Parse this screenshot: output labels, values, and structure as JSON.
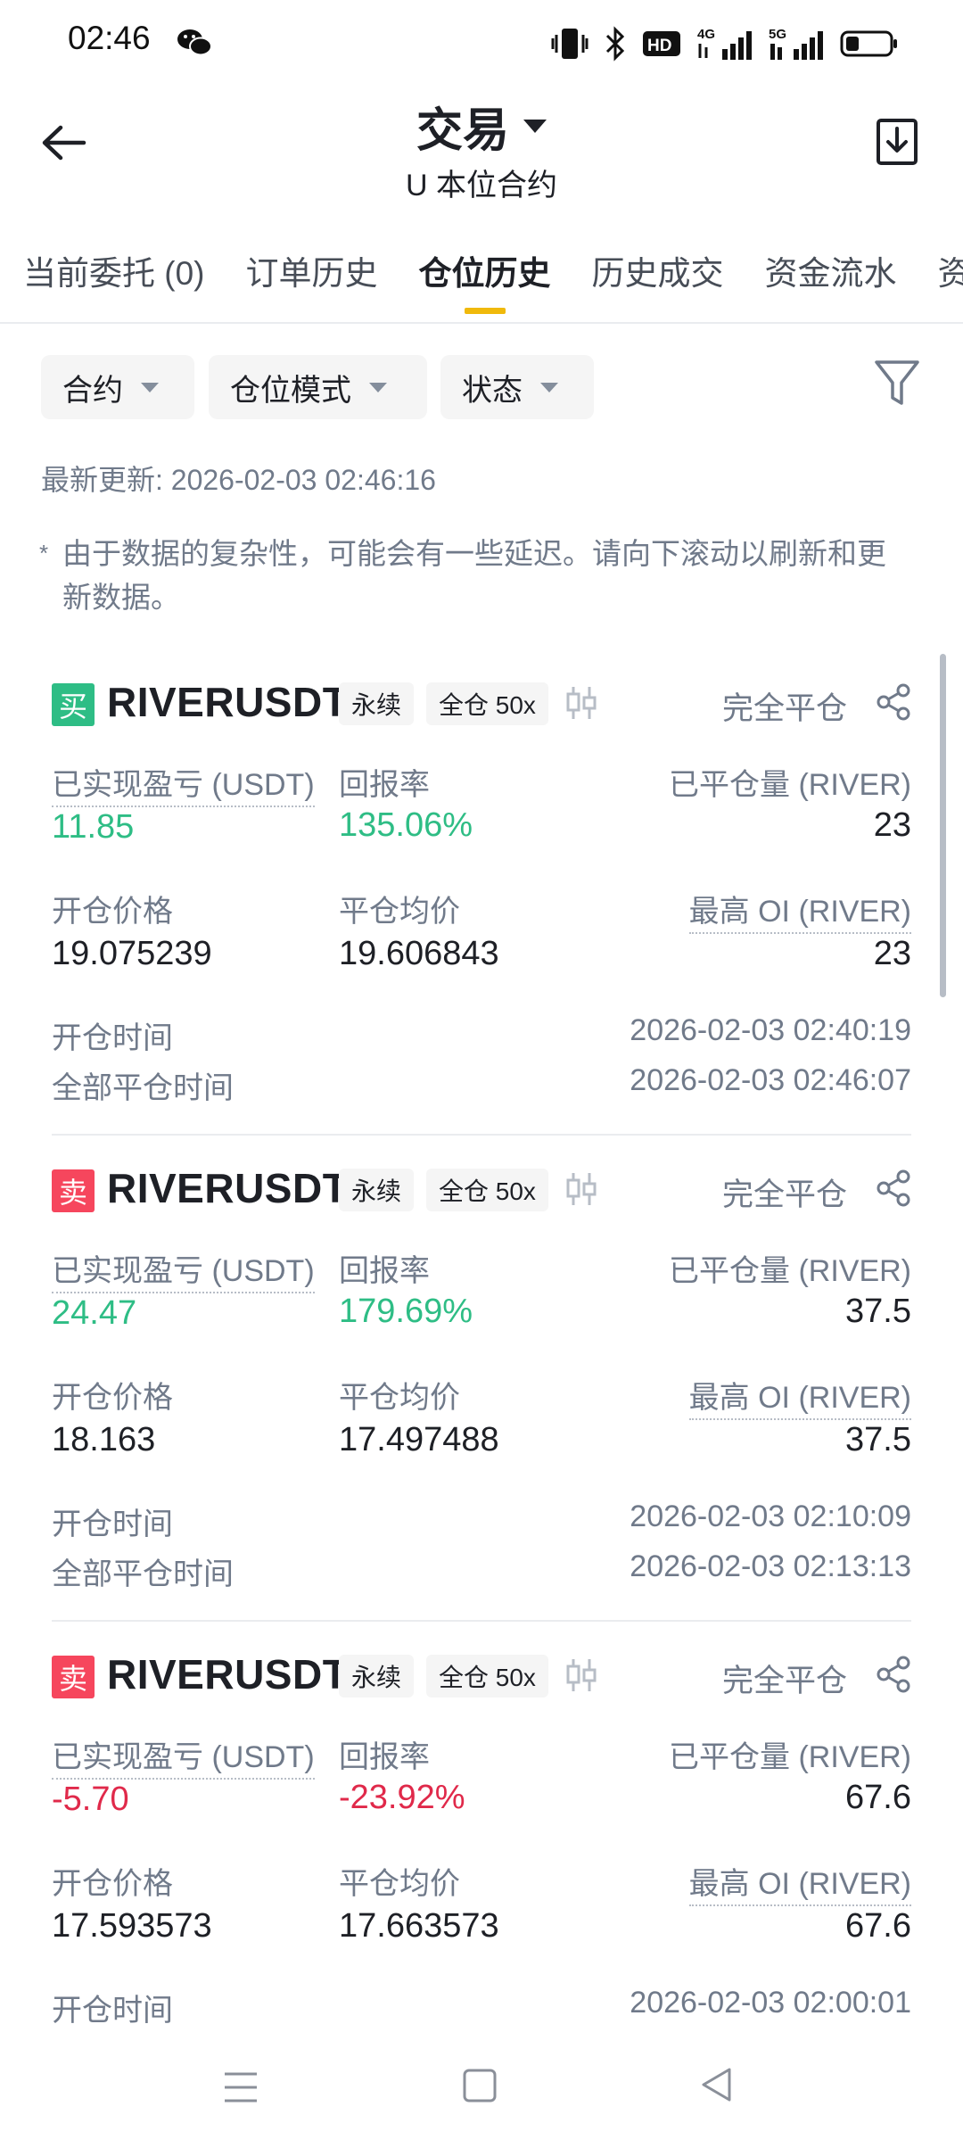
{
  "status_bar": {
    "time": "02:46"
  },
  "header": {
    "title": "交易",
    "subtitle": "U 本位合约"
  },
  "tabs": [
    {
      "label": "当前委托 (0)"
    },
    {
      "label": "订单历史"
    },
    {
      "label": "仓位历史",
      "active": true
    },
    {
      "label": "历史成交"
    },
    {
      "label": "资金流水"
    },
    {
      "label": "资"
    }
  ],
  "filters": {
    "contract": "合约",
    "position_mode": "仓位模式",
    "status": "状态"
  },
  "last_updated": "最新更新: 2026-02-03 02:46:16",
  "note_star": "*",
  "note": "由于数据的复杂性，可能会有一些延迟。请向下滚动以刷新和更新数据。",
  "labels": {
    "realized_pnl": "已实现盈亏 (USDT)",
    "roi": "回报率",
    "closed_qty": "已平仓量 (RIVER)",
    "open_price": "开仓价格",
    "avg_close_price": "平仓均价",
    "max_oi": "最高 OI (RIVER)",
    "open_time": "开仓时间",
    "close_time": "全部平仓时间"
  },
  "colors": {
    "buy": "#2ebd85",
    "sell": "#f6465d",
    "accent": "#f0b90b"
  },
  "positions": [
    {
      "side": "买",
      "symbol": "RIVERUSDT",
      "type": "永续",
      "margin": "全仓 50x",
      "status": "完全平仓",
      "realized_pnl": "11.85",
      "roi": "135.06%",
      "closed_qty": "23",
      "open_price": "19.075239",
      "avg_close_price": "19.606843",
      "max_oi": "23",
      "open_time": "2026-02-03 02:40:19",
      "close_time": "2026-02-03 02:46:07"
    },
    {
      "side": "卖",
      "symbol": "RIVERUSDT",
      "type": "永续",
      "margin": "全仓 50x",
      "status": "完全平仓",
      "realized_pnl": "24.47",
      "roi": "179.69%",
      "closed_qty": "37.5",
      "open_price": "18.163",
      "avg_close_price": "17.497488",
      "max_oi": "37.5",
      "open_time": "2026-02-03 02:10:09",
      "close_time": "2026-02-03 02:13:13"
    },
    {
      "side": "卖",
      "symbol": "RIVERUSDT",
      "type": "永续",
      "margin": "全仓 50x",
      "status": "完全平仓",
      "realized_pnl": "-5.70",
      "roi": "-23.92%",
      "closed_qty": "67.6",
      "open_price": "17.593573",
      "avg_close_price": "17.663573",
      "max_oi": "67.6",
      "open_time": "2026-02-03 02:00:01"
    }
  ]
}
